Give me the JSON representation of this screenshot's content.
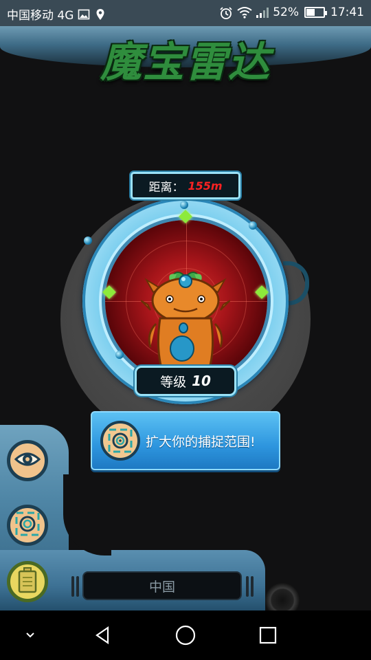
{
  "status_bar": {
    "carrier": "中国移动 4G",
    "battery_percent": "52%",
    "battery_level": 0.52,
    "time": "17:41",
    "icons": [
      "image-icon",
      "location-icon",
      "alarm-icon",
      "wifi-icon",
      "signal-icon",
      "battery-icon"
    ]
  },
  "header": {
    "title": "魔宝雷达"
  },
  "radar": {
    "distance_label": "距离：",
    "distance_value": "155m",
    "level_label": "等级",
    "level_value": "10"
  },
  "actions": {
    "expand_label": "扩大你的捕捉范围!"
  },
  "bottom_panel": {
    "region": "中国",
    "buttons": [
      "eye-icon",
      "target-icon",
      "battery-icon"
    ]
  },
  "colors": {
    "title_green": "#2f8d3d",
    "distance_red": "#ff2222",
    "button_blue": "#2d95de",
    "ring_cyan": "#9be2f7"
  },
  "nav": {
    "icons": [
      "chevron-down-icon",
      "back-icon",
      "home-icon",
      "recents-icon"
    ]
  }
}
